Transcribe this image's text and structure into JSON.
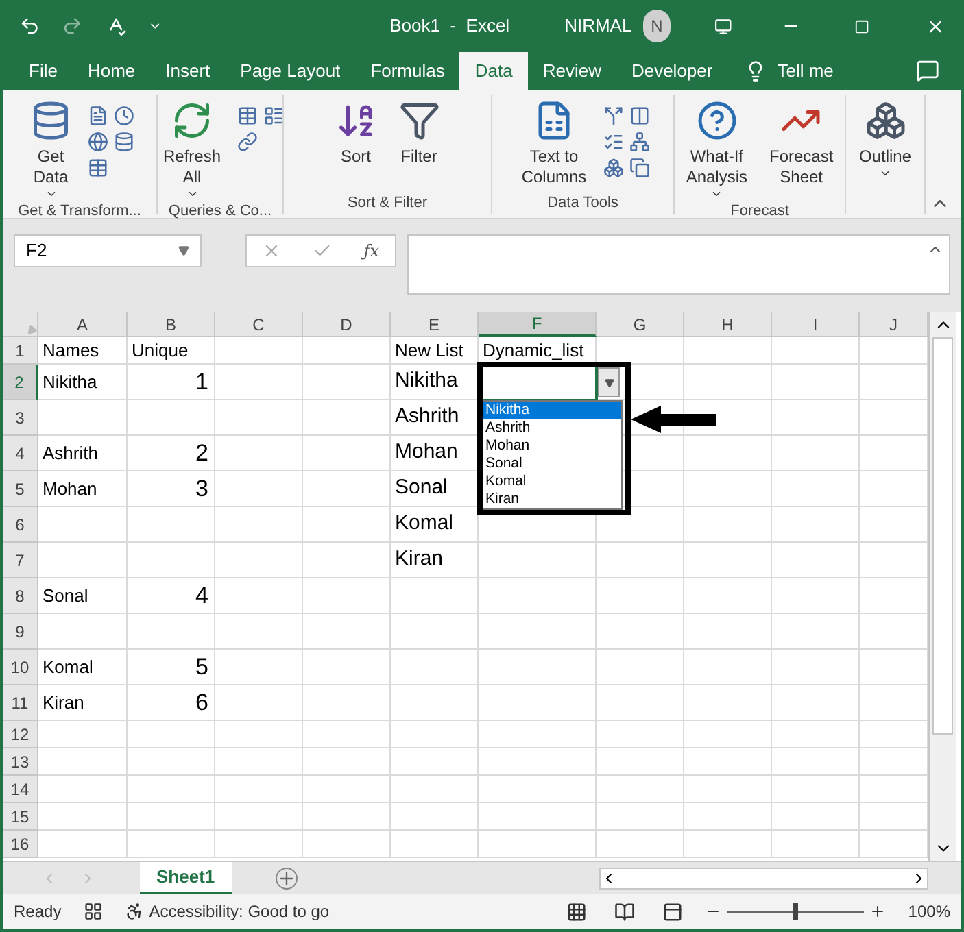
{
  "title_bar": {
    "title": "Book1  -  Excel",
    "user": "NIRMAL",
    "avatar": "N"
  },
  "tabs": [
    {
      "label": "File",
      "selected": false
    },
    {
      "label": "Home",
      "selected": false
    },
    {
      "label": "Insert",
      "selected": false
    },
    {
      "label": "Page Layout",
      "selected": false
    },
    {
      "label": "Formulas",
      "selected": false
    },
    {
      "label": "Data",
      "selected": true
    },
    {
      "label": "Review",
      "selected": false
    },
    {
      "label": "Developer",
      "selected": false
    }
  ],
  "tell_me": "Tell me",
  "ribbon_groups": [
    {
      "label": "Get & Transform...",
      "buttons": [
        {
          "lines": [
            "Get",
            "Data"
          ],
          "caret": true
        }
      ]
    },
    {
      "label": "Queries & Co...",
      "buttons": [
        {
          "lines": [
            "Refresh",
            "All"
          ],
          "caret": true
        }
      ]
    },
    {
      "label": "Sort & Filter",
      "buttons": [
        {
          "lines": [
            "Sort"
          ],
          "caret": false
        },
        {
          "lines": [
            "Filter"
          ],
          "caret": false
        }
      ]
    },
    {
      "label": "Data Tools",
      "buttons": [
        {
          "lines": [
            "Text to",
            "Columns"
          ],
          "caret": false
        }
      ]
    },
    {
      "label": "Forecast",
      "buttons": [
        {
          "lines": [
            "What-If",
            "Analysis"
          ],
          "caret": true
        },
        {
          "lines": [
            "Forecast",
            "Sheet"
          ],
          "caret": false
        }
      ]
    },
    {
      "buttons": [
        {
          "lines": [
            "Outline"
          ],
          "caret": true
        }
      ]
    }
  ],
  "name_box": "F2",
  "function_symbol": "ƒx",
  "columns": [
    {
      "label": "A",
      "selected": false
    },
    {
      "label": "B",
      "selected": false
    },
    {
      "label": "C",
      "selected": false
    },
    {
      "label": "D",
      "selected": false
    },
    {
      "label": "E",
      "selected": false
    },
    {
      "label": "F",
      "selected": true
    },
    {
      "label": "G",
      "selected": false
    },
    {
      "label": "H",
      "selected": false
    },
    {
      "label": "I",
      "selected": false
    },
    {
      "label": "J",
      "selected": false
    }
  ],
  "rows": [
    {
      "header": "1",
      "selected": false,
      "cells": [
        {
          "text": "Names",
          "kind": "text"
        },
        {
          "text": "Unique",
          "kind": "text"
        },
        {},
        {},
        {
          "text": "New List",
          "kind": "text"
        },
        {
          "text": "Dynamic_list",
          "kind": "text"
        }
      ]
    },
    {
      "header": "2",
      "selected": true,
      "cells": [
        {
          "text": "Nikitha",
          "kind": "text"
        },
        {
          "text": "1",
          "kind": "number"
        },
        {},
        {},
        {
          "text": "Nikitha",
          "kind": "large_text"
        }
      ]
    },
    {
      "header": "3",
      "selected": false,
      "cells": [
        {},
        {},
        {},
        {},
        {
          "text": "Ashrith",
          "kind": "large_text"
        }
      ]
    },
    {
      "header": "4",
      "selected": false,
      "cells": [
        {
          "text": "Ashrith",
          "kind": "text"
        },
        {
          "text": "2",
          "kind": "number"
        },
        {},
        {},
        {
          "text": "Mohan",
          "kind": "large_text"
        }
      ]
    },
    {
      "header": "5",
      "selected": false,
      "cells": [
        {
          "text": "Mohan",
          "kind": "text"
        },
        {
          "text": "3",
          "kind": "number"
        },
        {},
        {},
        {
          "text": "Sonal",
          "kind": "large_text"
        }
      ]
    },
    {
      "header": "6",
      "selected": false,
      "cells": [
        {},
        {},
        {},
        {},
        {
          "text": "Komal",
          "kind": "large_text"
        }
      ]
    },
    {
      "header": "7",
      "selected": false,
      "cells": [
        {},
        {},
        {},
        {},
        {
          "text": "Kiran",
          "kind": "large_text"
        }
      ]
    },
    {
      "header": "8",
      "selected": false,
      "cells": [
        {
          "text": "Sonal",
          "kind": "text"
        },
        {
          "text": "4",
          "kind": "number"
        }
      ]
    },
    {
      "header": "9",
      "selected": false
    },
    {
      "header": "10",
      "selected": false,
      "cells": [
        {
          "text": "Komal",
          "kind": "text"
        },
        {
          "text": "5",
          "kind": "number"
        }
      ]
    },
    {
      "header": "11",
      "selected": false,
      "cells": [
        {
          "text": "Kiran",
          "kind": "text"
        },
        {
          "text": "6",
          "kind": "number"
        }
      ]
    },
    {
      "header": "12",
      "selected": false
    },
    {
      "header": "13",
      "selected": false
    },
    {
      "header": "14",
      "selected": false
    },
    {
      "header": "15",
      "selected": false
    },
    {
      "header": "16",
      "selected": false
    }
  ],
  "dropdown": {
    "items": [
      {
        "label": "Nikitha",
        "selected": true
      },
      {
        "label": "Ashrith",
        "selected": false
      },
      {
        "label": "Mohan",
        "selected": false
      },
      {
        "label": "Sonal",
        "selected": false
      },
      {
        "label": "Komal",
        "selected": false
      },
      {
        "label": "Kiran",
        "selected": false
      }
    ]
  },
  "sheet_tabs": [
    {
      "label": "Sheet1",
      "selected": true
    }
  ],
  "status_bar": {
    "ready": "Ready",
    "accessibility": "Accessibility: Good to go",
    "zoom": "100%",
    "zoom_slider": {
      "level": 0.5
    }
  }
}
